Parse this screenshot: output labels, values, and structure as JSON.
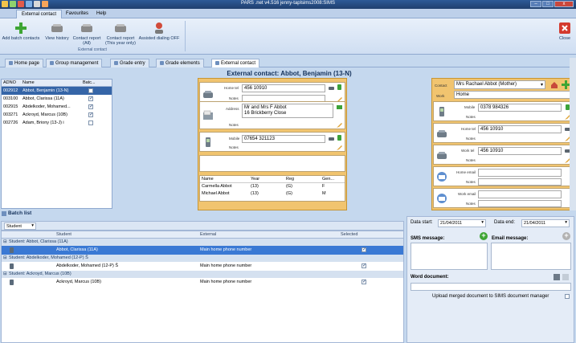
{
  "window": {
    "title": "PARS .net v4.516  jenny-taplsims2008:SIMS",
    "buttons": {
      "minimize": "–",
      "maximize": "□",
      "close": "x"
    }
  },
  "ribbon": {
    "tabs": [
      "External contact",
      "Favourites",
      "Help"
    ],
    "buttons": {
      "add_batch": "Add batch contacts",
      "view_history": "View history",
      "contact_report_all": "Contact report (All)",
      "contact_report_year": "Contact report (This year only)",
      "assisted_dialing": "Assisted dialing OFF",
      "close": "Close"
    },
    "group_label": "External contact"
  },
  "doctabs": [
    "Home page",
    "Group management",
    "Grade entry",
    "Grade elements",
    "External contact"
  ],
  "heading": "External contact: Abbot, Benjamin (13-N)",
  "student_list": {
    "headers": {
      "adno": "ADNO",
      "name": "Name",
      "batch": "Batc..."
    },
    "rows": [
      {
        "adno": "002912",
        "name": "Abbot, Benjamin (13-N)",
        "checked": false,
        "selected": true
      },
      {
        "adno": "003100",
        "name": "Abbot, Clarissa (11A)",
        "checked": true,
        "selected": false
      },
      {
        "adno": "002915",
        "name": "Abdelkoder, Mohamed...",
        "checked": true,
        "selected": false
      },
      {
        "adno": "003271",
        "name": "Ackroyd, Marcus (10B)",
        "checked": true,
        "selected": false
      },
      {
        "adno": "002726",
        "name": "Adam, Briony (13-J)  i",
        "checked": false,
        "selected": false
      }
    ]
  },
  "centre": {
    "home_tel_label": "Home tel",
    "home_tel": "456 10910",
    "notes_label": "Notes",
    "address_label": "Address",
    "address_line1": "Mr and Mrs F Abbot",
    "address_line2": "16 Brickberry Close",
    "mobile_label": "Mobile",
    "mobile": "07654 321123",
    "table": {
      "headers": [
        "Name",
        "Year",
        "Reg",
        "Gen..."
      ],
      "rows": [
        [
          "Carmella Abbot",
          "(13)",
          "(G)",
          "F"
        ],
        [
          "Michael Abbot",
          "(13)",
          "(G)",
          "M"
        ]
      ]
    }
  },
  "right": {
    "contact_label": "Contact",
    "contact_value": "Mrs Rachael Abbot (Mother)",
    "work_label": "Work",
    "work_value": "Home",
    "mobile_label": "Mobile",
    "mobile": "0378 984326",
    "home_tel_label": "Home tel",
    "home_tel": "456 10910",
    "work_tel_label": "Work tel",
    "work_tel": "456 10910",
    "home_email_label": "Home email",
    "work_email_label": "Work email",
    "notes_label": "Notes"
  },
  "batch": {
    "title": "Batch list",
    "dropdown": "Student",
    "headers": {
      "student": "Student",
      "external": "External",
      "selected": "Selected"
    },
    "groups": [
      {
        "label": "Student: Abbot, Clarissa (11A)",
        "row": {
          "student": "Abbot, Clarissa (11A)",
          "external": "Main home phone number",
          "selected": true,
          "highlight": true
        }
      },
      {
        "label": "Student: Abdelkoder, Mohamed (12-P)  Ŝ",
        "row": {
          "student": "Abdelkoder, Mohamed (12-P)  Ŝ",
          "external": "Main home phone number",
          "selected": true,
          "highlight": false
        }
      },
      {
        "label": "Student: Ackroyd, Marcus (10B)",
        "row": {
          "student": "Ackroyd, Marcus (10B)",
          "external": "Main home phone number",
          "selected": true,
          "highlight": false
        }
      }
    ]
  },
  "messages": {
    "date_start_label": "Data start:",
    "date_start": "21/04/2011",
    "date_end_label": "Data end:",
    "date_end": "21/04/2011",
    "sms_label": "SMS message:",
    "email_label": "Email message:",
    "word_label": "Word document:",
    "upload_label": "Upload merged document to SIMS document manager"
  },
  "colors": {
    "accent": "#3565a7",
    "panel": "#f1c46f",
    "ribbon": "#cfdef2"
  }
}
